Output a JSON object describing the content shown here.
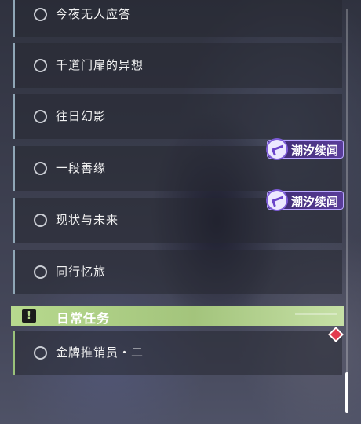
{
  "quests": [
    {
      "title": "今夜无人应答"
    },
    {
      "title": "千道门扉的异想"
    },
    {
      "title": "往日幻影"
    },
    {
      "title": "一段善缘",
      "tag": "潮汐续闻"
    },
    {
      "title": "现状与未来",
      "tag": "潮汐续闻"
    },
    {
      "title": "同行忆旅"
    }
  ],
  "daily": {
    "header_icon": "!",
    "header_title": "日常任务",
    "items": [
      {
        "title": "金牌推销员・二"
      }
    ]
  },
  "colors": {
    "daily_accent": "#b7d98e",
    "tag_purple": "#5a3d9a",
    "alert_red": "#e23a4e"
  }
}
